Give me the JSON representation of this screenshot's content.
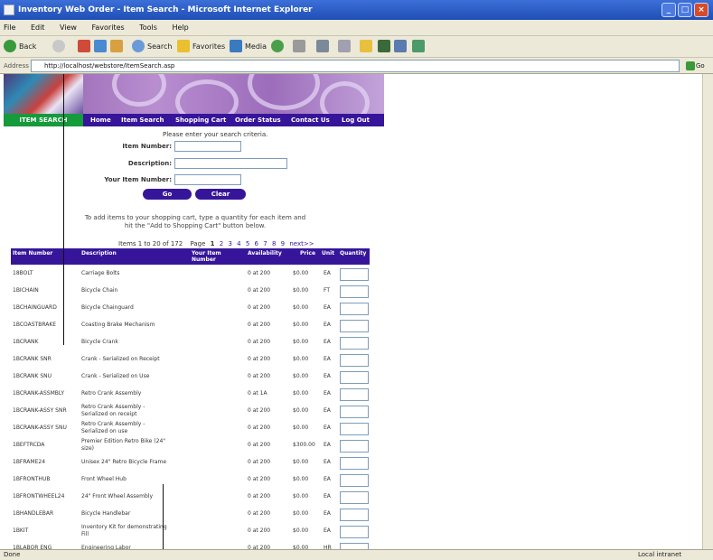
{
  "window": {
    "title": "Inventory Web Order - Item Search - Microsoft Internet Explorer",
    "minimize": "_",
    "maximize": "□",
    "close": "×"
  },
  "menu": [
    "File",
    "Edit",
    "View",
    "Favorites",
    "Tools",
    "Help"
  ],
  "toolbar": {
    "back": "Back",
    "search": "Search",
    "favorites": "Favorites",
    "media": "Media"
  },
  "address": {
    "label": "Address",
    "url": "http://localhost/webstore/ItemSearch.asp",
    "go": "Go"
  },
  "site": {
    "section_title": "ITEM SEARCH",
    "nav": [
      "Home",
      "Item Search",
      "Shopping Cart",
      "Order Status",
      "Contact Us",
      "Log Out"
    ]
  },
  "search": {
    "hint": "Please enter your search criteria.",
    "item_number_label": "Item Number:",
    "description_label": "Description:",
    "your_item_number_label": "Your Item Number:",
    "go_button": "Go",
    "clear_button": "Clear"
  },
  "instructions": {
    "line1": "To add items to your shopping cart, type a quantity for each item and",
    "line2": "hit the \"Add to Shopping Cart\" button below."
  },
  "pager": {
    "text": "Items 1 to 20 of 172",
    "page_label": "Page",
    "current": "1",
    "pages": [
      "2",
      "3",
      "4",
      "5",
      "6",
      "7",
      "8",
      "9"
    ],
    "next": "next>>"
  },
  "table": {
    "headers": [
      "Item Number",
      "Description",
      "Your Item Number",
      "Availability",
      "Price",
      "Unit",
      "Quantity"
    ],
    "rows": [
      {
        "item": "18BOLT",
        "desc": "Carriage Bolts",
        "desc2": "",
        "avail": "0 at 200",
        "price": "$0.00",
        "unit": "EA"
      },
      {
        "item": "1BICHAIN",
        "desc": "Bicycle Chain",
        "desc2": "",
        "avail": "0 at 200",
        "price": "$0.00",
        "unit": "FT"
      },
      {
        "item": "1BCHAINGUARD",
        "desc": "Bicycle Chainguard",
        "desc2": "",
        "avail": "0 at 200",
        "price": "$0.00",
        "unit": "EA"
      },
      {
        "item": "1BCOASTBRAKE",
        "desc": "Coasting Brake Mechanism",
        "desc2": "",
        "avail": "0 at 200",
        "price": "$0.00",
        "unit": "EA"
      },
      {
        "item": "1BCRANK",
        "desc": "Bicycle Crank",
        "desc2": "",
        "avail": "0 at 200",
        "price": "$0.00",
        "unit": "EA"
      },
      {
        "item": "1BCRANK SNR",
        "desc": "Crank - Serialized on Receipt",
        "desc2": "",
        "avail": "0 at 200",
        "price": "$0.00",
        "unit": "EA"
      },
      {
        "item": "1BCRANK SNU",
        "desc": "Crank - Serialized on Use",
        "desc2": "",
        "avail": "0 at 200",
        "price": "$0.00",
        "unit": "EA"
      },
      {
        "item": "1BCRANK-ASSMBLY",
        "desc": "Retro Crank Assembly",
        "desc2": "",
        "avail": "0 at 1A",
        "price": "$0.00",
        "unit": "EA"
      },
      {
        "item": "1BCRANK-ASSY SNR",
        "desc": "Retro Crank Assembly -",
        "desc2": "Serialized on receipt",
        "avail": "0 at 200",
        "price": "$0.00",
        "unit": "EA"
      },
      {
        "item": "1BCRANK-ASSY SNU",
        "desc": "Retro Crank Assembly -",
        "desc2": "Serialized on use",
        "avail": "0 at 200",
        "price": "$0.00",
        "unit": "EA"
      },
      {
        "item": "1BEFTRCDA",
        "desc": "Premier Edition Retro Bike (24\"",
        "desc2": "size)",
        "avail": "0 at 200",
        "price": "$300.00",
        "unit": "EA"
      },
      {
        "item": "1BFRAME24",
        "desc": "Unisex 24\" Retro Bicycle Frame",
        "desc2": "",
        "avail": "0 at 200",
        "price": "$0.00",
        "unit": "EA"
      },
      {
        "item": "1BFRONTHUB",
        "desc": "Front Wheel Hub",
        "desc2": "",
        "avail": "0 at 200",
        "price": "$0.00",
        "unit": "EA"
      },
      {
        "item": "1BFRONTWHEEL24",
        "desc": "24\" Front Wheel Assembly",
        "desc2": "",
        "avail": "0 at 200",
        "price": "$0.00",
        "unit": "EA"
      },
      {
        "item": "1BHANDLEBAR",
        "desc": "Bicycle Handlebar",
        "desc2": "",
        "avail": "0 at 200",
        "price": "$0.00",
        "unit": "EA"
      },
      {
        "item": "1BKIT",
        "desc": "Inventory Kit for demonstrating",
        "desc2": "Fill",
        "avail": "0 at 200",
        "price": "$0.00",
        "unit": "EA"
      },
      {
        "item": "1BLABOR ENG",
        "desc": "Engineering Labor",
        "desc2": "",
        "avail": "0 at 200",
        "price": "$0.00",
        "unit": "HR"
      }
    ]
  },
  "status": {
    "left": "Done",
    "right": "Local intranet"
  }
}
